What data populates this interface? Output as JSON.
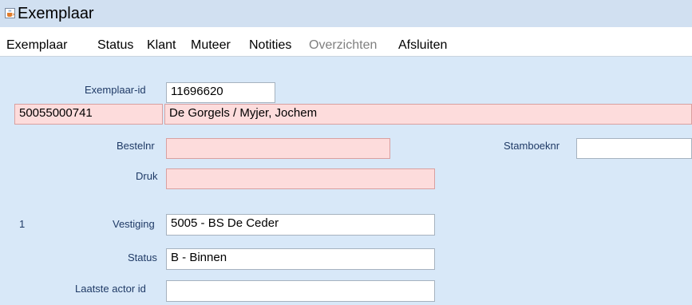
{
  "window": {
    "title": "Exemplaar",
    "icon": "java-coffee-icon"
  },
  "menu": {
    "items": [
      {
        "label": "Exemplaar",
        "enabled": true
      },
      {
        "label": "Status",
        "enabled": true
      },
      {
        "label": "Klant",
        "enabled": true
      },
      {
        "label": "Muteer",
        "enabled": true
      },
      {
        "label": "Notities",
        "enabled": true
      },
      {
        "label": "Overzichten",
        "enabled": false
      },
      {
        "label": "Afsluiten",
        "enabled": true
      }
    ]
  },
  "form": {
    "exemplaar_id_label": "Exemplaar-id",
    "exemplaar_id_value": "11696620",
    "barcode_value": "50055000741",
    "title_author_value": "De Gorgels / Myjer, Jochem",
    "bestelnr_label": "Bestelnr",
    "bestelnr_value": "",
    "stamboeknr_label": "Stamboeknr",
    "stamboeknr_value": "",
    "druk_label": "Druk",
    "druk_value": "",
    "row_number": "1",
    "vestiging_label": "Vestiging",
    "vestiging_value": "5005 - BS De Ceder",
    "status_label": "Status",
    "status_value": "B - Binnen",
    "laatste_actor_label": "Laatste actor id",
    "laatste_actor_value": ""
  },
  "colors": {
    "background": "#d8e8f8",
    "required_field": "#fddcdc",
    "label_text": "#1f3a66",
    "disabled_menu": "#7f7f7f"
  }
}
